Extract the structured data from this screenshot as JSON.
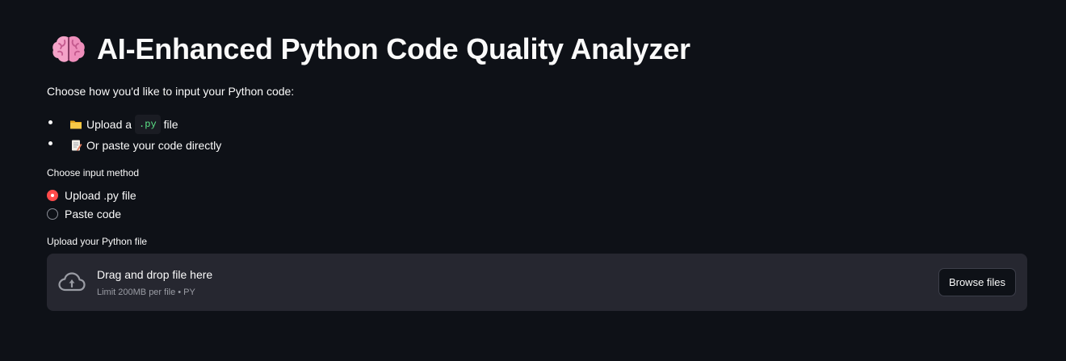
{
  "header": {
    "title": "AI-Enhanced Python Code Quality Analyzer",
    "title_icon": "brain-icon"
  },
  "intro": {
    "text": "Choose how you'd like to input your Python code:",
    "options": [
      {
        "icon": "folder-icon",
        "prefix": "Upload a",
        "code": ".py",
        "suffix": "file"
      },
      {
        "icon": "memo-icon",
        "text": "Or paste your code directly"
      }
    ]
  },
  "input_method": {
    "label": "Choose input method",
    "options": [
      "Upload .py file",
      "Paste code"
    ],
    "selected": "Upload .py file"
  },
  "uploader": {
    "label": "Upload your Python file",
    "drop_text": "Drag and drop file here",
    "limit_text": "Limit 200MB per file • PY",
    "browse_label": "Browse files",
    "icon": "cloud-upload-icon"
  },
  "colors": {
    "background": "#0e1117",
    "accent": "#ff4b4b",
    "dropzone": "#262730",
    "code_text": "#5ce488"
  }
}
